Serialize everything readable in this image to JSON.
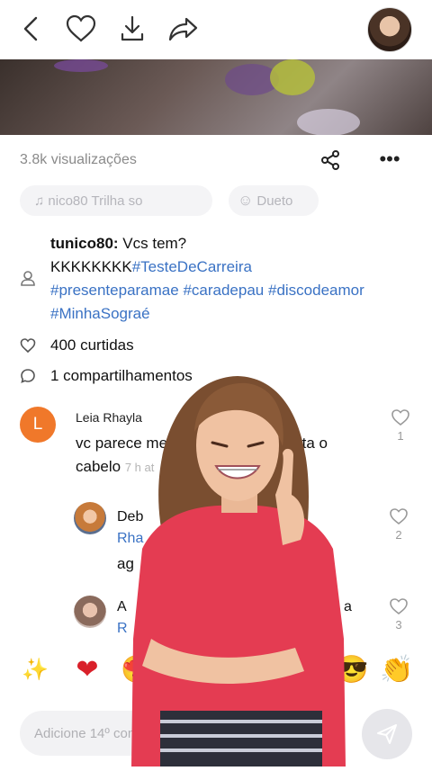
{
  "header": {
    "back_icon": "chevron-left-icon",
    "like_icon": "heart-outline-icon",
    "download_icon": "download-icon",
    "share_icon": "forward-arrow-icon",
    "avatar_icon": "user-avatar"
  },
  "stats": {
    "views": "3.8k visualizações",
    "likes": "400 curtidas",
    "shares": "1 compartilhamentos"
  },
  "chips": {
    "music": "♫ nico80   Trilha so",
    "duet": "Dueto"
  },
  "caption": {
    "author": "tunico80:",
    "text": " Vcs tem?",
    "line2_prefix": "KKKKKKKK",
    "tags": [
      "#TesteDeCarreira",
      "#presenteparamae",
      "#caradepau",
      "#discodeamor",
      "#MinhaSograé"
    ]
  },
  "comments": [
    {
      "name": "Leia Rhayla",
      "text": "vc parece me",
      "text2": "corta o",
      "text3": "cabelo",
      "time": "7 h at",
      "likes": "1",
      "avatar_letter": "L"
    },
    {
      "name": "Deb",
      "text": "Rha",
      "text2": "ag",
      "likes": "2"
    },
    {
      "name": "A",
      "text": "R",
      "text_right": "a",
      "likes": "3"
    }
  ],
  "input": {
    "placeholder": "Adicione 14º com"
  },
  "colors": {
    "accent": "#3a72c4",
    "avatar_orange": "#f0782a"
  }
}
